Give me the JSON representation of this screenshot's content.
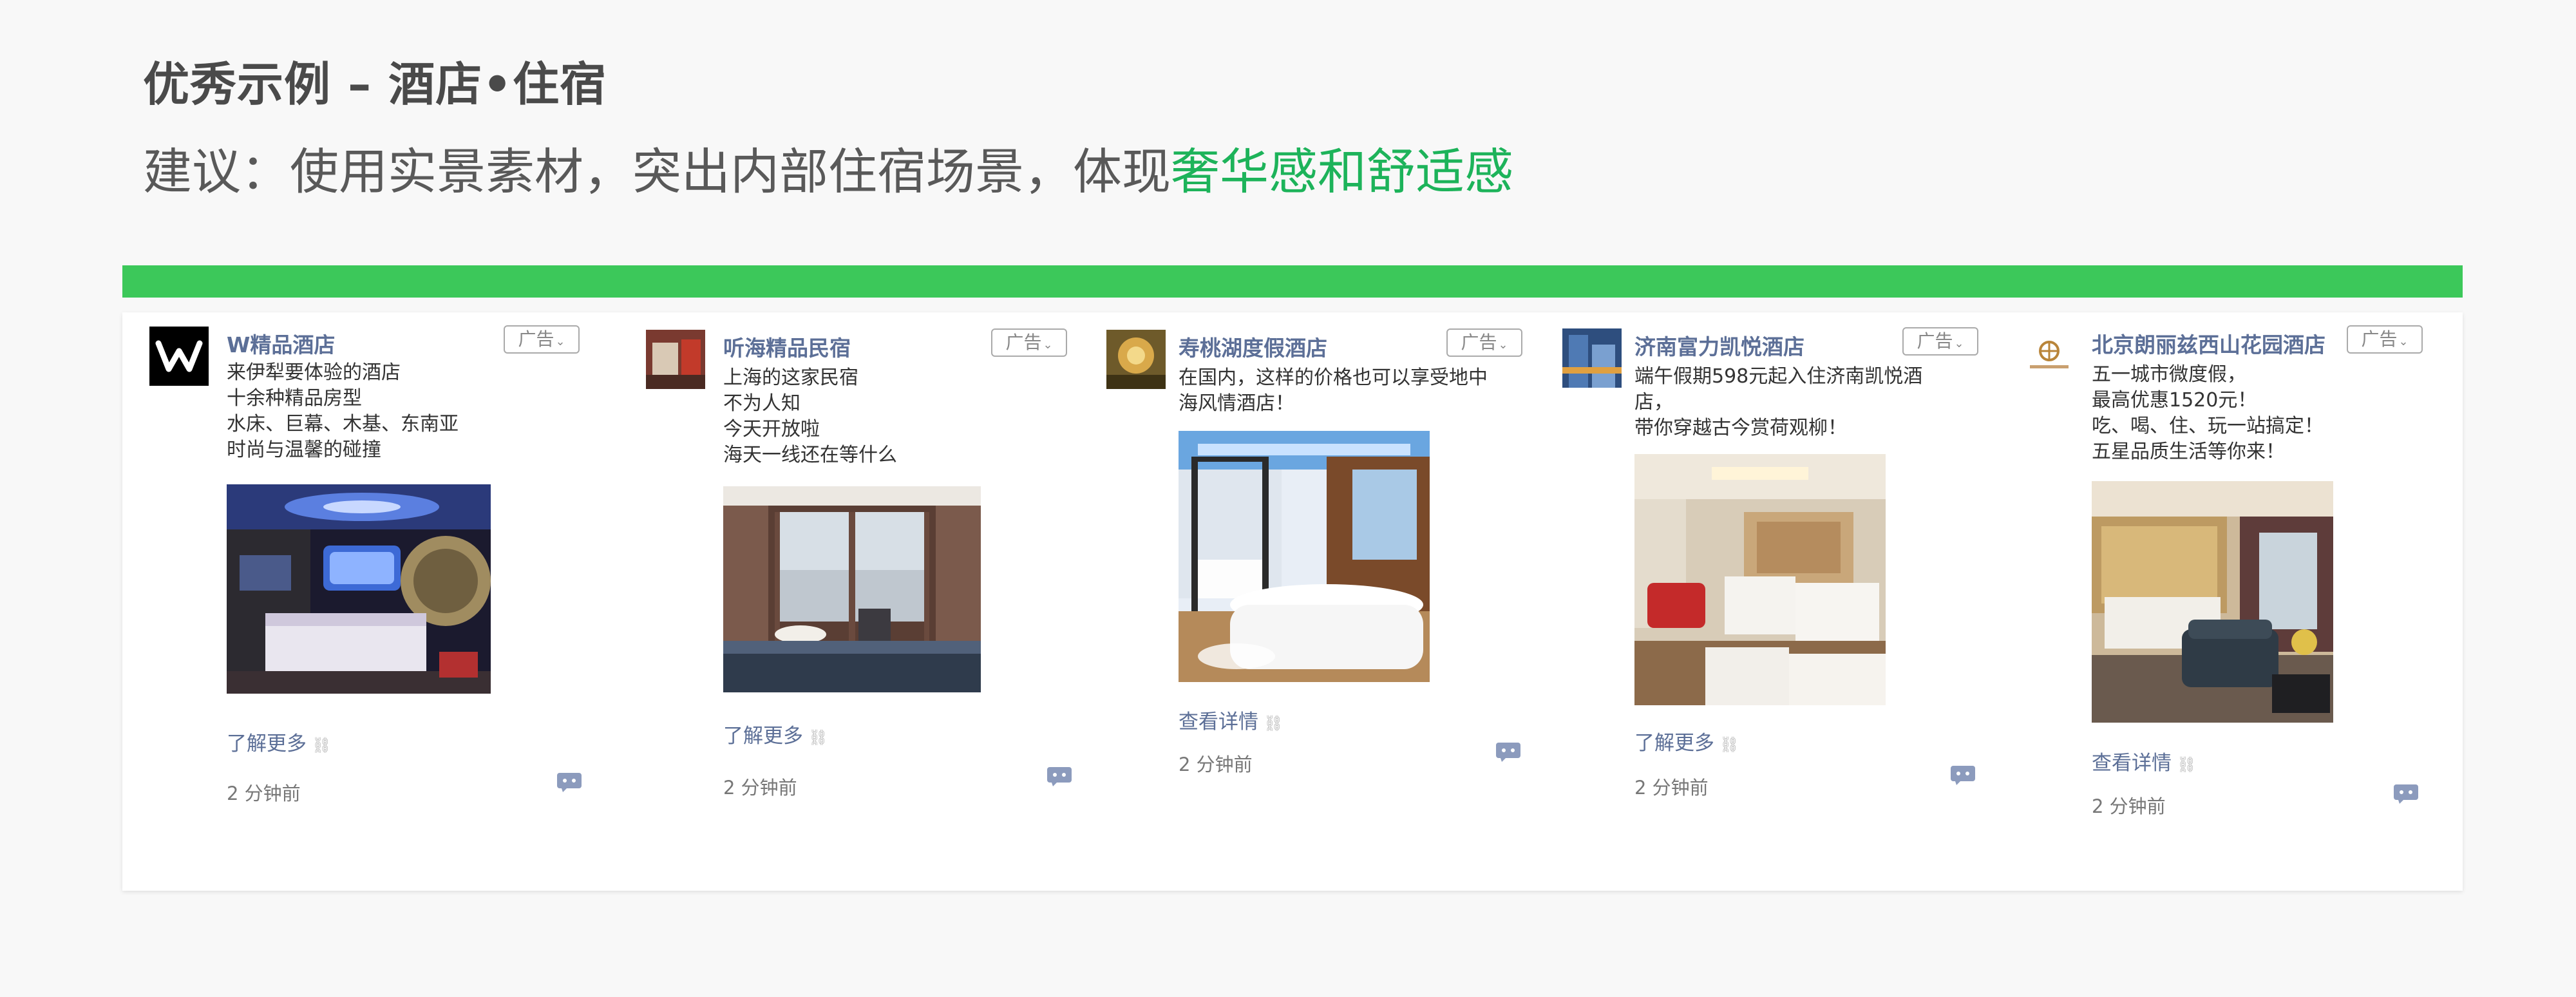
{
  "header": {
    "title": "优秀示例 – 酒店•住宿",
    "suggestion_prefix": "建议：使用实景素材，突出内部住宿场景，体现",
    "suggestion_highlight": "奢华感和舒适感"
  },
  "colors": {
    "accent_green": "#3cc85a",
    "highlight_green": "#1db35a",
    "link_blue": "#5c6f97"
  },
  "ad_label": "广告",
  "posts": [
    {
      "name": "W精品酒店",
      "lines": [
        "来伊犁要体验的酒店",
        "十余种精品房型",
        "水床、巨幕、木基、东南亚",
        "时尚与温馨的碰撞"
      ],
      "link": "了解更多",
      "time": "2 分钟前",
      "avatar_icon": "w-logo-icon",
      "photo": "w-hotel-room-photo"
    },
    {
      "name": "听海精品民宿",
      "lines": [
        "上海的这家民宿",
        "不为人知",
        "今天开放啦",
        "海天一线还在等什么"
      ],
      "link": "了解更多",
      "time": "2 分钟前",
      "avatar_icon": "room-thumbnail-icon",
      "photo": "seaview-room-photo"
    },
    {
      "name": "寿桃湖度假酒店",
      "lines": [
        "在国内，这样的价格也可以享受地中",
        "海风情酒店！"
      ],
      "link": "查看详情",
      "time": "2 分钟前",
      "avatar_icon": "resort-thumbnail-icon",
      "photo": "bathtub-suite-photo"
    },
    {
      "name": "济南富力凯悦酒店",
      "lines": [
        "端午假期598元起入住济南凯悦酒",
        "店，",
        "带你穿越古今赏荷观柳！"
      ],
      "link": "了解更多",
      "time": "2 分钟前",
      "avatar_icon": "hotel-building-icon",
      "photo": "twin-bed-room-photo"
    },
    {
      "name": "北京朗丽兹西山花园酒店",
      "lines": [
        "五一城市微度假，",
        "最高优惠1520元！",
        "吃、喝、住、玩一站搞定！",
        "五星品质生活等你来！"
      ],
      "link": "查看详情",
      "time": "2 分钟前",
      "avatar_icon": "hotel-crest-logo-icon",
      "photo": "suite-living-room-photo"
    }
  ]
}
